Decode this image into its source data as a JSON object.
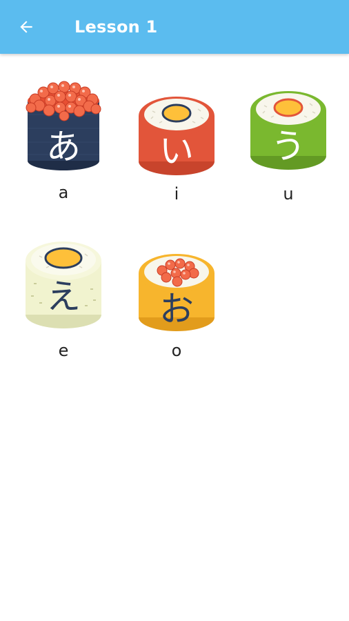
{
  "app_bar": {
    "title": "Lesson 1",
    "back_icon": "arrow-back-icon",
    "background": "#5bbcef"
  },
  "cards": [
    {
      "kana": "あ",
      "romaji": "a",
      "style": "gunkan-ikura",
      "wrap_color": "#2c3e5e",
      "kana_color": "#ffffff"
    },
    {
      "kana": "い",
      "romaji": "i",
      "style": "roll-egg",
      "wrap_color": "#e2553a",
      "kana_color": "#ffffff"
    },
    {
      "kana": "う",
      "romaji": "u",
      "style": "roll-egg",
      "wrap_color": "#7ab82f",
      "kana_color": "#ffffff"
    },
    {
      "kana": "え",
      "romaji": "e",
      "style": "roll-egg",
      "wrap_color": "#f1f3cf",
      "kana_color": "#2c3e5e"
    },
    {
      "kana": "お",
      "romaji": "o",
      "style": "roll-ikura",
      "wrap_color": "#f7b52d",
      "kana_color": "#2c3e5e"
    }
  ]
}
